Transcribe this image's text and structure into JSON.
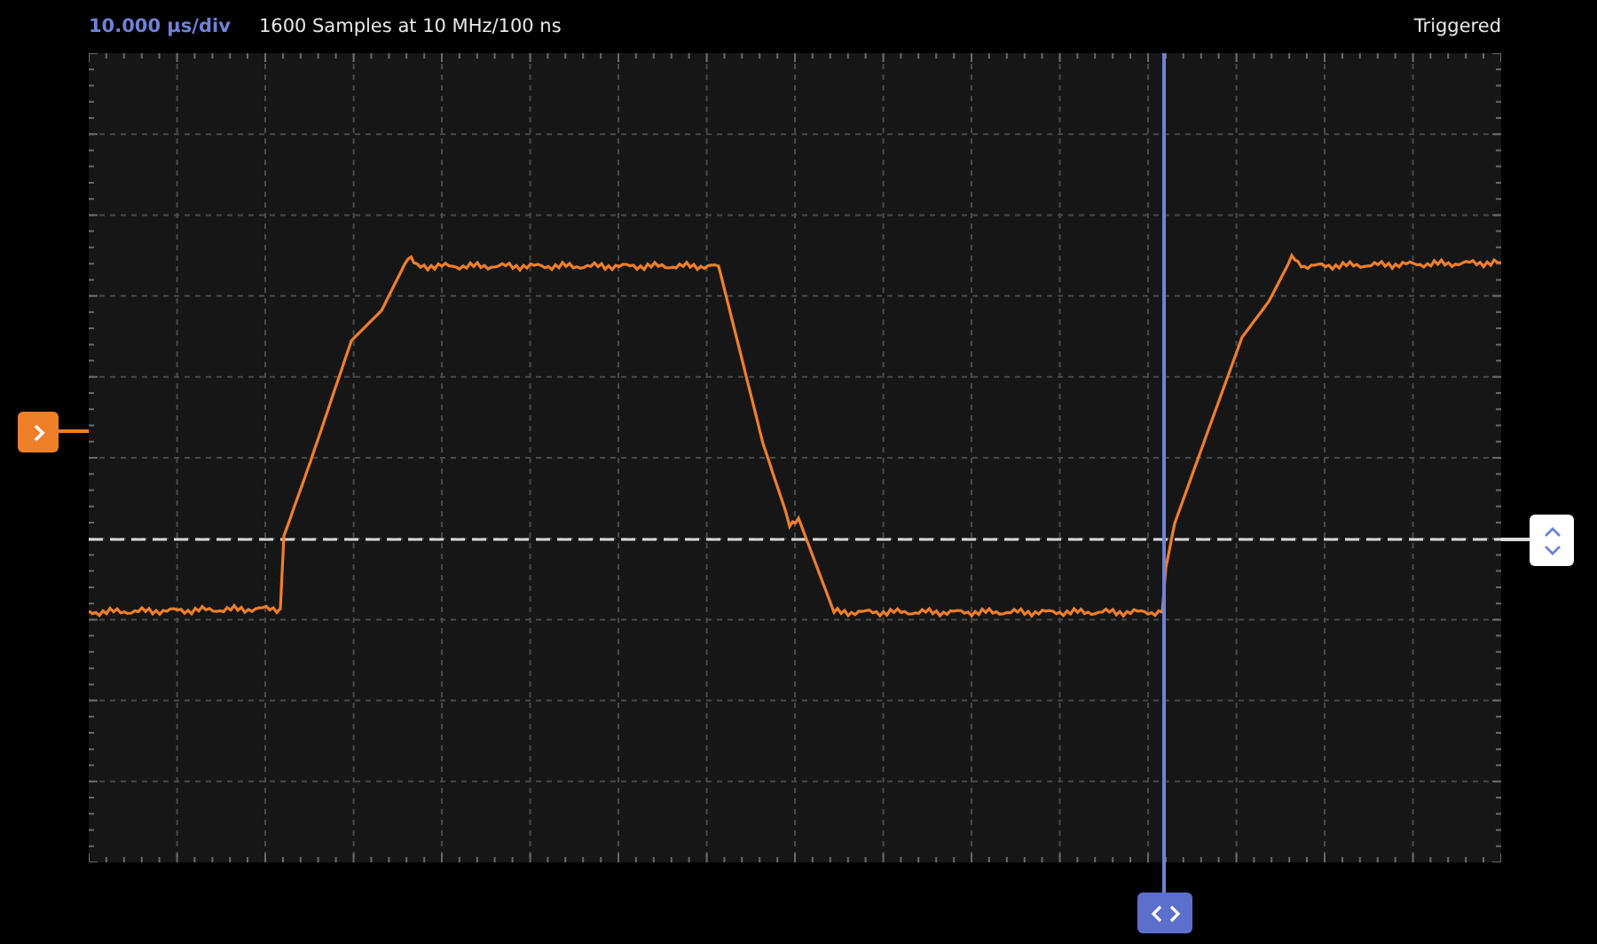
{
  "header": {
    "timebase": "10.000 µs/div",
    "acquisition": "1600 Samples at 10 MHz/100 ns",
    "status": "Triggered"
  }
}
